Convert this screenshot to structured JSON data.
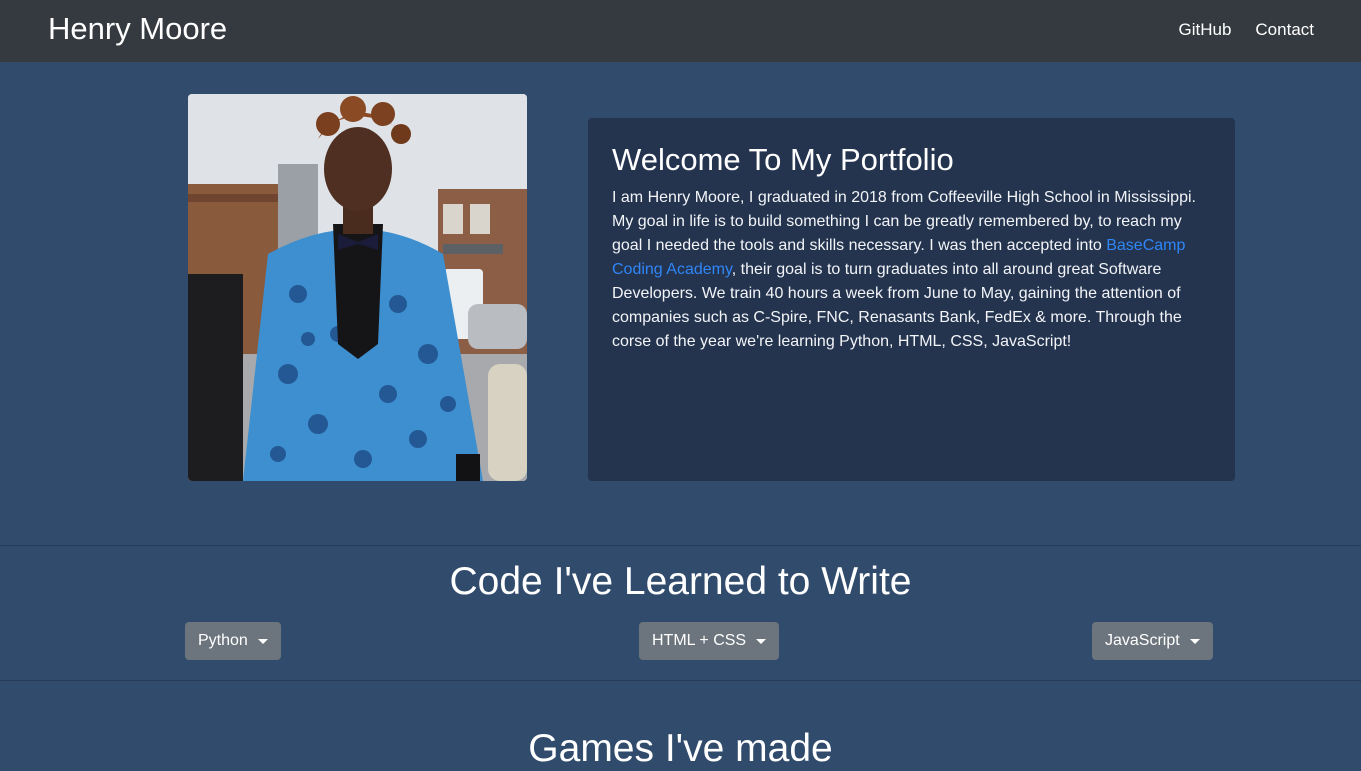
{
  "navbar": {
    "brand": "Henry Moore",
    "links": [
      "GitHub",
      "Contact"
    ]
  },
  "hero": {
    "photo_alt": "Henry Moore portrait",
    "title": "Welcome To My Portfolio",
    "bio_before_link": "I am Henry Moore, I graduated in 2018 from Coffeeville High School in Mississippi. My goal in life is to build something I can be greatly remembered by, to reach my goal I needed the tools and skills necessary. I was then accepted into ",
    "bio_link": "BaseCamp Coding Academy",
    "bio_after_link": ", their goal is to turn graduates into all around great Software Developers. We train 40 hours a week from June to May, gaining the attention of companies such as C-Spire, FNC, Renasants Bank, FedEx & more. Through the corse of the year we're learning Python, HTML, CSS, JavaScript!"
  },
  "code_section": {
    "title": "Code I've Learned to Write",
    "dropdowns": [
      "Python",
      "HTML + CSS",
      "JavaScript"
    ]
  },
  "games_section": {
    "title": "Games I've made"
  },
  "colors": {
    "navbar": "#343a40",
    "background": "#304b6b",
    "card": "#24344f",
    "link": "#2f86f6",
    "button": "#6c757d"
  }
}
